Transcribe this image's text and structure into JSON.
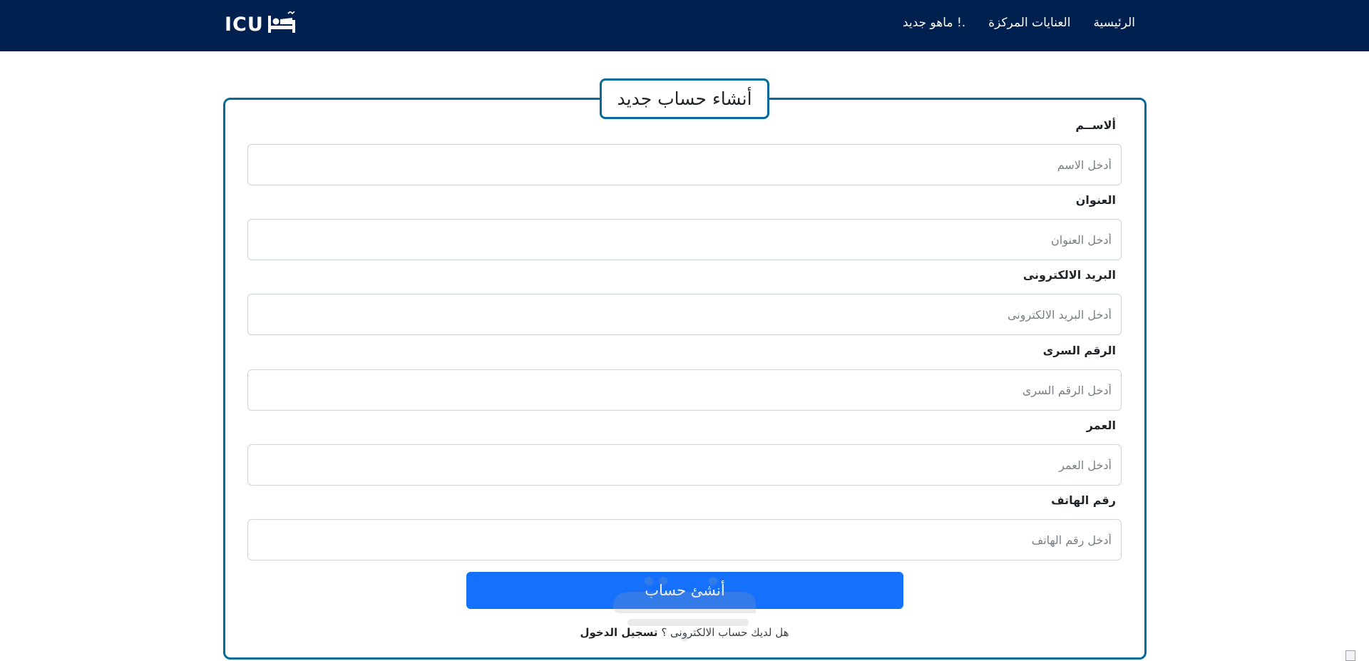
{
  "navbar": {
    "logo_text": "ICU",
    "logo_icon": "bed-icon",
    "links": [
      {
        "label": "الرئيسية"
      },
      {
        "label": "العنايات المركزة"
      },
      {
        "label": "ماهو جديد !."
      }
    ],
    "background": "#00204f"
  },
  "form": {
    "title": "أنشاء حساب جديد",
    "fields": [
      {
        "label": "ألاســم",
        "placeholder": "أدخل الاسم",
        "value": ""
      },
      {
        "label": "العنوان",
        "placeholder": "أدخل العنوان",
        "value": ""
      },
      {
        "label": "البريد الالكترونى",
        "placeholder": "أدخل البريد الالكترونى",
        "value": ""
      },
      {
        "label": "الرقم السرى",
        "placeholder": "أدخل الرقم السرى",
        "value": ""
      },
      {
        "label": "العمر",
        "placeholder": "أدخل العمر",
        "value": ""
      },
      {
        "label": "رقم الهاتف",
        "placeholder": "أدخل رقم الهاتف",
        "value": ""
      }
    ],
    "submit_label": "أنشئ حساب",
    "login_prompt": "هل لديك حساب الالكترونى ؟",
    "login_link": "تسجيل الدخول",
    "accent_color": "#086a9a",
    "button_color": "#1570fb"
  }
}
